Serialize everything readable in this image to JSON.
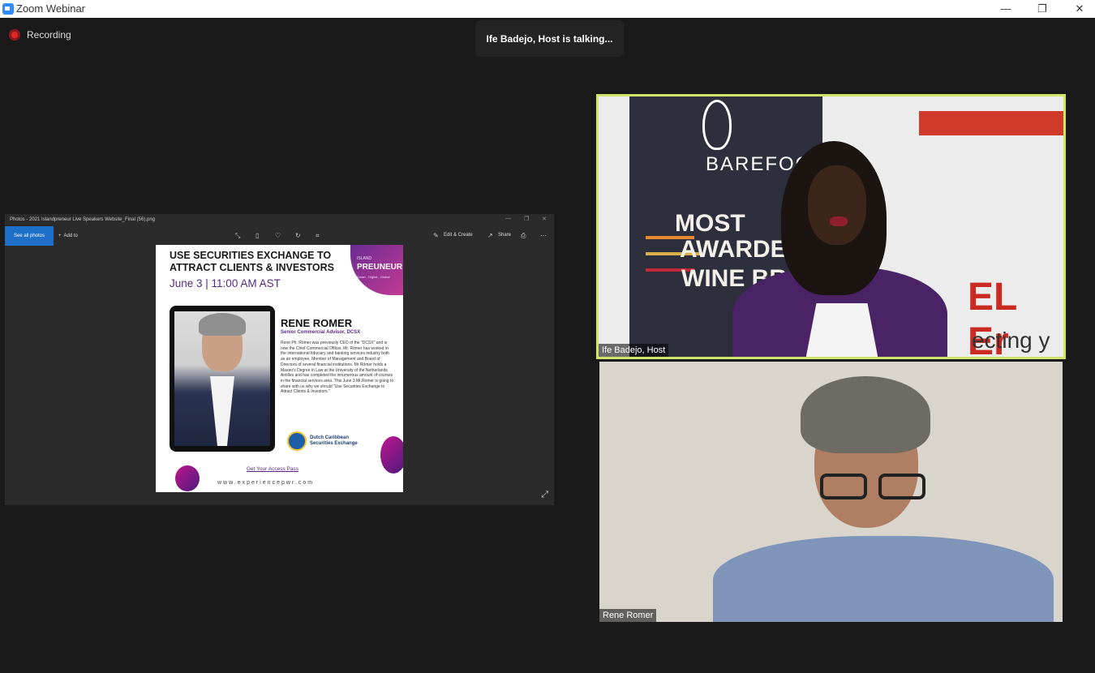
{
  "window": {
    "title": "Zoom Webinar",
    "controls": {
      "minimize": "—",
      "restore": "❐",
      "close": "✕"
    }
  },
  "recording": {
    "label": "Recording"
  },
  "talking": {
    "text": "Ife Badejo, Host is talking..."
  },
  "share": {
    "app_title": "Photos - 2021 Islandpreneur Live Speakers Website_Final (56).png",
    "toolbar": {
      "see_all": "See all photos",
      "add_to": "Add to",
      "edit_create": "Edit & Create",
      "share": "Share"
    },
    "flyer": {
      "heading": "USE SECURITIES EXCHANGE TO ATTRACT CLIENTS & INVESTORS",
      "date": "June 3 | 11:00 AM AST",
      "logo_main": "PREUNEUR",
      "logo_sub": "ISLAND",
      "logo_tag": "Smart - Digital - Global",
      "speaker_name": "RENE ROMER",
      "speaker_role": "Senior Commercial Advisor, DCSX",
      "bio": "René Ph. Römer was previously CEO of the \"DCSX\" and is now the Chief Commercial Officer. Mr. Römer has worked in the international fiduciary and banking services industry both as an employee, Member of Management and Board of Directors of several financial institutions. Mr Römer holds a Master's Degree in Law at the University of the Netherlands Antilles and has completed the innumerous amount of courses in the financial services area. This June 3 Mr.Romer is going to share with us why we should \"Use Securities Exchange to Attract Clients & Investors.\"",
      "exchange": "Dutch Caribbean Securities Exchange",
      "cta": "Get Your Access Pass",
      "website": "www.experiencepwr.com"
    }
  },
  "tiles": {
    "host": {
      "name": "Ife Badejo, Host",
      "bg_brand": "BAREFOOT",
      "bg_line1": "MOST",
      "bg_line2": "AWARDED",
      "bg_line3": "WINE BRA",
      "bg_sign": "EL Er",
      "bg_sign_sub": "ecting y"
    },
    "guest": {
      "name": "Rene Romer"
    }
  },
  "colors": {
    "speaker_border": "#d1e46a",
    "recording_dot": "#e02828",
    "accent_purple": "#5a2a82",
    "photos_accent": "#1d6fc8"
  }
}
